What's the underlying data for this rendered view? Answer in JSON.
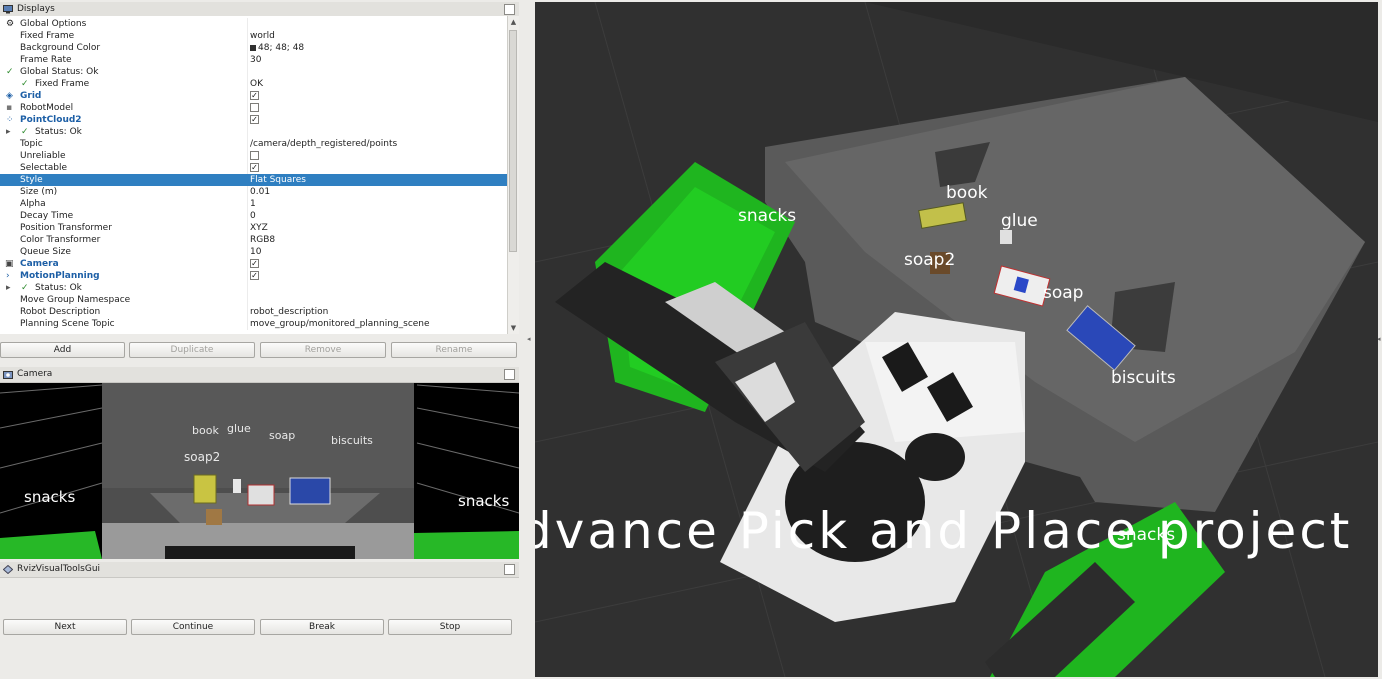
{
  "displays_panel": {
    "title": "Displays",
    "rows": [
      {
        "name": "Global Options",
        "value": "",
        "indent": 20
      },
      {
        "name": "Fixed Frame",
        "value": "world",
        "indent": 20
      },
      {
        "name": "Background Color",
        "value": "48; 48; 48",
        "indent": 20
      },
      {
        "name": "Frame Rate",
        "value": "30",
        "indent": 20
      },
      {
        "name": "Global Status: Ok",
        "value": "",
        "indent": 20
      },
      {
        "name": "Fixed Frame",
        "value": "OK",
        "indent": 35
      },
      {
        "name": "Grid",
        "value": "",
        "indent": 20
      },
      {
        "name": "RobotModel",
        "value": "",
        "indent": 20
      },
      {
        "name": "PointCloud2",
        "value": "",
        "indent": 20
      },
      {
        "name": "Status: Ok",
        "value": "",
        "indent": 35
      },
      {
        "name": "Topic",
        "value": "/camera/depth_registered/points",
        "indent": 20
      },
      {
        "name": "Unreliable",
        "value": "",
        "indent": 20
      },
      {
        "name": "Selectable",
        "value": "",
        "indent": 20
      },
      {
        "name": "Style",
        "value": "Flat Squares",
        "indent": 20
      },
      {
        "name": "Size (m)",
        "value": "0.01",
        "indent": 20
      },
      {
        "name": "Alpha",
        "value": "1",
        "indent": 20
      },
      {
        "name": "Decay Time",
        "value": "0",
        "indent": 20
      },
      {
        "name": "Position Transformer",
        "value": "XYZ",
        "indent": 20
      },
      {
        "name": "Color Transformer",
        "value": "RGB8",
        "indent": 20
      },
      {
        "name": "Queue Size",
        "value": "10",
        "indent": 20
      },
      {
        "name": "Camera",
        "value": "",
        "indent": 20
      },
      {
        "name": "MotionPlanning",
        "value": "",
        "indent": 20
      },
      {
        "name": "Status: Ok",
        "value": "",
        "indent": 35
      },
      {
        "name": "Move Group Namespace",
        "value": "",
        "indent": 20
      },
      {
        "name": "Robot Description",
        "value": "robot_description",
        "indent": 20
      },
      {
        "name": "Planning Scene Topic",
        "value": "move_group/monitored_planning_scene",
        "indent": 20
      }
    ],
    "buttons": {
      "add": "Add",
      "duplicate": "Duplicate",
      "remove": "Remove",
      "rename": "Rename"
    }
  },
  "camera_panel": {
    "title": "Camera",
    "labels": {
      "book": "book",
      "glue": "glue",
      "soap": "soap",
      "biscuits": "biscuits",
      "soap2": "soap2",
      "snacks_left": "snacks",
      "snacks_right": "snacks"
    }
  },
  "rviz_panel": {
    "title": "RvizVisualToolsGui",
    "buttons": {
      "next": "Next",
      "continue": "Continue",
      "break": "Break",
      "stop": "Stop"
    }
  },
  "view3d": {
    "banner": "dvance  Pick  and  Place  project",
    "labels": {
      "snacks_top": "snacks",
      "book": "book",
      "glue": "glue",
      "soap2": "soap2",
      "soap": "soap",
      "biscuits": "biscuits",
      "snacks_bottom": "snacks"
    }
  },
  "colors": {
    "selection": "#2f7fc1",
    "background": "#303030",
    "bin_green": "#2fc12f"
  }
}
